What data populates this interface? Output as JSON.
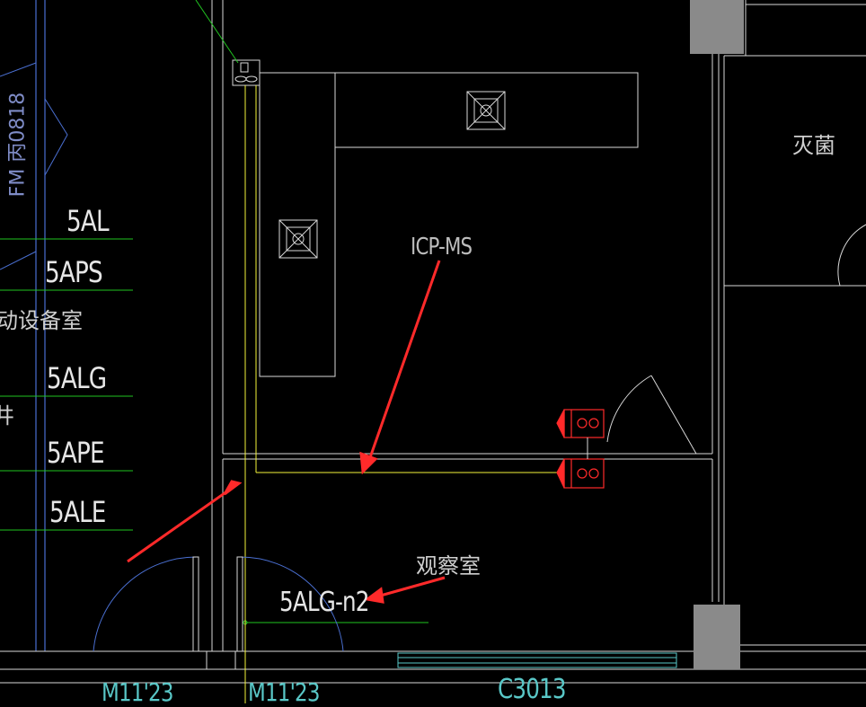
{
  "drawing": {
    "background": "#000000",
    "colors": {
      "wall": "#d7d7d7",
      "green": "#21c421",
      "yellow": "#f5f53a",
      "red": "#ff2a2a",
      "blue": "#4a6fd1",
      "gray_fill": "#8a8a8a",
      "cyan": "#59c7c7"
    }
  },
  "labels": {
    "icp_ms": "ICP-MS",
    "sterilize": "灭菌",
    "observation_room": "观察室",
    "aux_equipment_room": "动设备室",
    "circuit_5al": "5AL",
    "circuit_5aps": "5APS",
    "circuit_5alg": "5ALG",
    "circuit_5ape": "5APE",
    "circuit_5ale": "5ALE",
    "circuit_5alg_n2": "5ALG-n2",
    "door_left": "M11'23",
    "door_right": "M11'23",
    "window": "C3013",
    "rotated_text": "FM 丙0818",
    "side_char": "井"
  }
}
